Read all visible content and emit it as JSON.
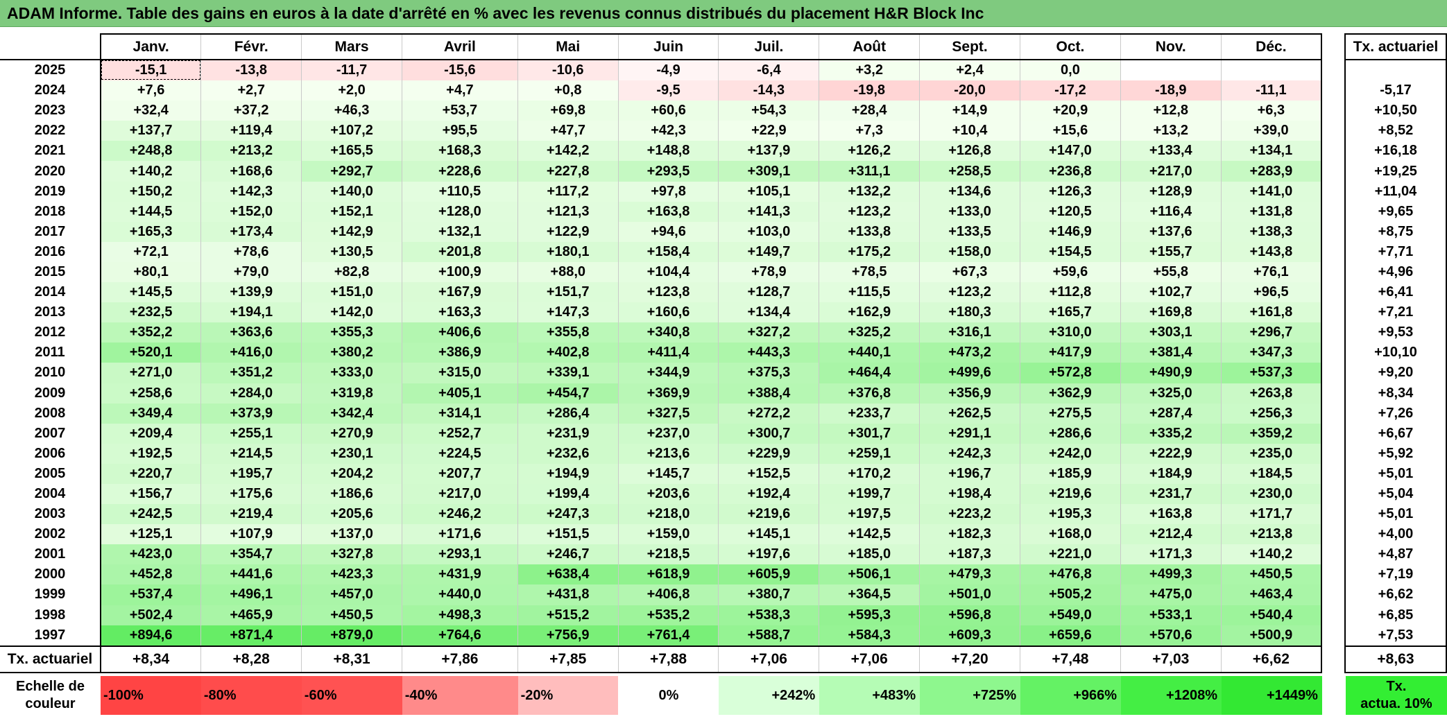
{
  "title": "ADAM Informe. Table des gains en euros à la date d'arrêté en % avec les revenus connus distribués du placement H&R Block Inc",
  "months": [
    "Janv.",
    "Févr.",
    "Mars",
    "Avril",
    "Mai",
    "Juin",
    "Juil.",
    "Août",
    "Sept.",
    "Oct.",
    "Nov.",
    "Déc."
  ],
  "tx_header": "Tx. actuariel",
  "rows": [
    {
      "year": "2025",
      "values": [
        "-15,1",
        "-13,8",
        "-11,7",
        "-15,6",
        "-10,6",
        "-4,9",
        "-6,4",
        "+3,2",
        "+2,4",
        "0,0",
        "",
        ""
      ],
      "tx": ""
    },
    {
      "year": "2024",
      "values": [
        "+7,6",
        "+2,7",
        "+2,0",
        "+4,7",
        "+0,8",
        "-9,5",
        "-14,3",
        "-19,8",
        "-20,0",
        "-17,2",
        "-18,9",
        "-11,1"
      ],
      "tx": "-5,17"
    },
    {
      "year": "2023",
      "values": [
        "+32,4",
        "+37,2",
        "+46,3",
        "+53,7",
        "+69,8",
        "+60,6",
        "+54,3",
        "+28,4",
        "+14,9",
        "+20,9",
        "+12,8",
        "+6,3"
      ],
      "tx": "+10,50"
    },
    {
      "year": "2022",
      "values": [
        "+137,7",
        "+119,4",
        "+107,2",
        "+95,5",
        "+47,7",
        "+42,3",
        "+22,9",
        "+7,3",
        "+10,4",
        "+15,6",
        "+13,2",
        "+39,0"
      ],
      "tx": "+8,52"
    },
    {
      "year": "2021",
      "values": [
        "+248,8",
        "+213,2",
        "+165,5",
        "+168,3",
        "+142,2",
        "+148,8",
        "+137,9",
        "+126,2",
        "+126,8",
        "+147,0",
        "+133,4",
        "+134,1"
      ],
      "tx": "+16,18"
    },
    {
      "year": "2020",
      "values": [
        "+140,2",
        "+168,6",
        "+292,7",
        "+228,6",
        "+227,8",
        "+293,5",
        "+309,1",
        "+311,1",
        "+258,5",
        "+236,8",
        "+217,0",
        "+283,9"
      ],
      "tx": "+19,25"
    },
    {
      "year": "2019",
      "values": [
        "+150,2",
        "+142,3",
        "+140,0",
        "+110,5",
        "+117,2",
        "+97,8",
        "+105,1",
        "+132,2",
        "+134,6",
        "+126,3",
        "+128,9",
        "+141,0"
      ],
      "tx": "+11,04"
    },
    {
      "year": "2018",
      "values": [
        "+144,5",
        "+152,0",
        "+152,1",
        "+128,0",
        "+121,3",
        "+163,8",
        "+141,3",
        "+123,2",
        "+133,0",
        "+120,5",
        "+116,4",
        "+131,8"
      ],
      "tx": "+9,65"
    },
    {
      "year": "2017",
      "values": [
        "+165,3",
        "+173,4",
        "+142,9",
        "+132,1",
        "+122,9",
        "+94,6",
        "+103,0",
        "+133,8",
        "+133,5",
        "+146,9",
        "+137,6",
        "+138,3"
      ],
      "tx": "+8,75"
    },
    {
      "year": "2016",
      "values": [
        "+72,1",
        "+78,6",
        "+130,5",
        "+201,8",
        "+180,1",
        "+158,4",
        "+149,7",
        "+175,2",
        "+158,0",
        "+154,5",
        "+155,7",
        "+143,8"
      ],
      "tx": "+7,71"
    },
    {
      "year": "2015",
      "values": [
        "+80,1",
        "+79,0",
        "+82,8",
        "+100,9",
        "+88,0",
        "+104,4",
        "+78,9",
        "+78,5",
        "+67,3",
        "+59,6",
        "+55,8",
        "+76,1"
      ],
      "tx": "+4,96"
    },
    {
      "year": "2014",
      "values": [
        "+145,5",
        "+139,9",
        "+151,0",
        "+167,9",
        "+151,7",
        "+123,8",
        "+128,7",
        "+115,5",
        "+123,2",
        "+112,8",
        "+102,7",
        "+96,5"
      ],
      "tx": "+6,41"
    },
    {
      "year": "2013",
      "values": [
        "+232,5",
        "+194,1",
        "+142,0",
        "+163,3",
        "+147,3",
        "+160,6",
        "+134,4",
        "+162,9",
        "+180,3",
        "+165,7",
        "+169,8",
        "+161,8"
      ],
      "tx": "+7,21"
    },
    {
      "year": "2012",
      "values": [
        "+352,2",
        "+363,6",
        "+355,3",
        "+406,6",
        "+355,8",
        "+340,8",
        "+327,2",
        "+325,2",
        "+316,1",
        "+310,0",
        "+303,1",
        "+296,7"
      ],
      "tx": "+9,53"
    },
    {
      "year": "2011",
      "values": [
        "+520,1",
        "+416,0",
        "+380,2",
        "+386,9",
        "+402,8",
        "+411,4",
        "+443,3",
        "+440,1",
        "+473,2",
        "+417,9",
        "+381,4",
        "+347,3"
      ],
      "tx": "+10,10"
    },
    {
      "year": "2010",
      "values": [
        "+271,0",
        "+351,2",
        "+333,0",
        "+315,0",
        "+339,1",
        "+344,9",
        "+375,3",
        "+464,4",
        "+499,6",
        "+572,8",
        "+490,9",
        "+537,3"
      ],
      "tx": "+9,20"
    },
    {
      "year": "2009",
      "values": [
        "+258,6",
        "+284,0",
        "+319,8",
        "+405,1",
        "+454,7",
        "+369,9",
        "+388,4",
        "+376,8",
        "+356,9",
        "+362,9",
        "+325,0",
        "+263,8"
      ],
      "tx": "+8,34"
    },
    {
      "year": "2008",
      "values": [
        "+349,4",
        "+373,9",
        "+342,4",
        "+314,1",
        "+286,4",
        "+327,5",
        "+272,2",
        "+233,7",
        "+262,5",
        "+275,5",
        "+287,4",
        "+256,3"
      ],
      "tx": "+7,26"
    },
    {
      "year": "2007",
      "values": [
        "+209,4",
        "+255,1",
        "+270,9",
        "+252,7",
        "+231,9",
        "+237,0",
        "+300,7",
        "+301,7",
        "+291,1",
        "+286,6",
        "+335,2",
        "+359,2"
      ],
      "tx": "+6,67"
    },
    {
      "year": "2006",
      "values": [
        "+192,5",
        "+214,5",
        "+230,1",
        "+224,5",
        "+232,6",
        "+213,6",
        "+229,9",
        "+259,1",
        "+242,3",
        "+242,0",
        "+222,9",
        "+235,0"
      ],
      "tx": "+5,92"
    },
    {
      "year": "2005",
      "values": [
        "+220,7",
        "+195,7",
        "+204,2",
        "+207,7",
        "+194,9",
        "+145,7",
        "+152,5",
        "+170,2",
        "+196,7",
        "+185,9",
        "+184,9",
        "+184,5"
      ],
      "tx": "+5,01"
    },
    {
      "year": "2004",
      "values": [
        "+156,7",
        "+175,6",
        "+186,6",
        "+217,0",
        "+199,4",
        "+203,6",
        "+192,4",
        "+199,7",
        "+198,4",
        "+219,6",
        "+231,7",
        "+230,0"
      ],
      "tx": "+5,04"
    },
    {
      "year": "2003",
      "values": [
        "+242,5",
        "+219,4",
        "+205,6",
        "+246,2",
        "+247,3",
        "+218,0",
        "+219,6",
        "+197,5",
        "+223,2",
        "+195,3",
        "+163,8",
        "+171,7"
      ],
      "tx": "+5,01"
    },
    {
      "year": "2002",
      "values": [
        "+125,1",
        "+107,9",
        "+137,0",
        "+171,6",
        "+151,5",
        "+159,0",
        "+145,1",
        "+142,5",
        "+182,3",
        "+168,0",
        "+212,4",
        "+213,8"
      ],
      "tx": "+4,00"
    },
    {
      "year": "2001",
      "values": [
        "+423,0",
        "+354,7",
        "+327,8",
        "+293,1",
        "+246,7",
        "+218,5",
        "+197,6",
        "+185,0",
        "+187,3",
        "+221,0",
        "+171,3",
        "+140,2"
      ],
      "tx": "+4,87"
    },
    {
      "year": "2000",
      "values": [
        "+452,8",
        "+441,6",
        "+423,3",
        "+431,9",
        "+638,4",
        "+618,9",
        "+605,9",
        "+506,1",
        "+479,3",
        "+476,8",
        "+499,3",
        "+450,5"
      ],
      "tx": "+7,19"
    },
    {
      "year": "1999",
      "values": [
        "+537,4",
        "+496,1",
        "+457,0",
        "+440,0",
        "+431,8",
        "+406,8",
        "+380,7",
        "+364,5",
        "+501,0",
        "+505,2",
        "+475,0",
        "+463,4"
      ],
      "tx": "+6,62"
    },
    {
      "year": "1998",
      "values": [
        "+502,4",
        "+465,9",
        "+450,5",
        "+498,3",
        "+515,2",
        "+535,2",
        "+538,3",
        "+595,3",
        "+596,8",
        "+549,0",
        "+533,1",
        "+540,4"
      ],
      "tx": "+6,85"
    },
    {
      "year": "1997",
      "values": [
        "+894,6",
        "+871,4",
        "+879,0",
        "+764,6",
        "+756,9",
        "+761,4",
        "+588,7",
        "+584,3",
        "+609,3",
        "+659,6",
        "+570,6",
        "+500,9"
      ],
      "tx": "+7,53"
    }
  ],
  "footer": {
    "label": "Tx. actuariel",
    "values": [
      "+8,34",
      "+8,28",
      "+8,31",
      "+7,86",
      "+7,85",
      "+7,88",
      "+7,06",
      "+7,06",
      "+7,20",
      "+7,48",
      "+7,03",
      "+6,62"
    ],
    "total": "+8,63"
  },
  "scale": {
    "label_line1": "Echelle de",
    "label_line2": "couleur",
    "items": [
      "-100%",
      "-80%",
      "-60%",
      "-40%",
      "-20%",
      "0%",
      "+242%",
      "+483%",
      "+725%",
      "+966%",
      "+1208%",
      "+1449%"
    ],
    "tx_line1": "Tx.",
    "tx_line2": "actua. 10%"
  },
  "colors": {
    "title_bg": "#7fca7f",
    "neg_max": "#ff3b3b",
    "pos_max": "#33ee33",
    "tx_green": "#33ee33"
  }
}
